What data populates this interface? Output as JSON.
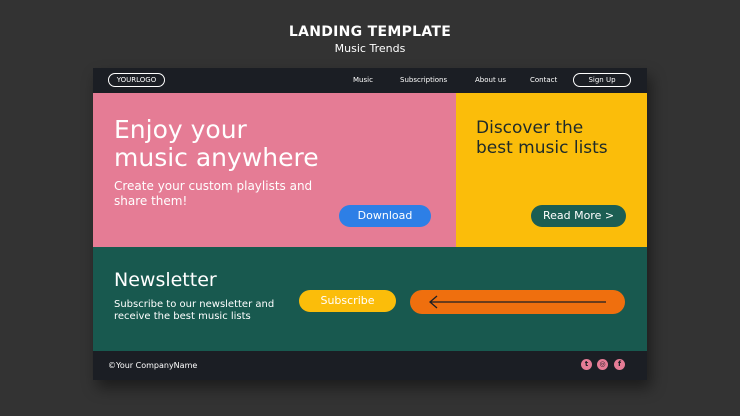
{
  "heading": {
    "title": "LANDING TEMPLATE",
    "subtitle": "Music Trends"
  },
  "nav": {
    "logo": "YOURLOGO",
    "links": [
      "Music",
      "Subscriptions",
      "About us",
      "Contact"
    ],
    "signup": "Sign Up"
  },
  "hero": {
    "title_line1": "Enjoy your",
    "title_line2": "music anywhere",
    "subtitle": "Create your custom playlists and share them!",
    "download_label": "Download"
  },
  "discover": {
    "title_line1": "Discover the",
    "title_line2": "best music lists",
    "readmore_label": "Read More >"
  },
  "newsletter": {
    "title": "Newsletter",
    "text": "Subscribe to our newsletter and receive the best music lists",
    "subscribe_label": "Subscribe",
    "field_icon": "arrow-left-icon"
  },
  "footer": {
    "copyright": "©Your CompanyName",
    "social": [
      {
        "icon": "twitter-icon",
        "glyph": "t"
      },
      {
        "icon": "instagram-icon",
        "glyph": "◎"
      },
      {
        "icon": "facebook-icon",
        "glyph": "f"
      }
    ]
  },
  "colors": {
    "background": "#333333",
    "mockup_dark": "#1b1e24",
    "pink": "#e57c95",
    "yellow": "#fbbd0a",
    "green": "#18594f",
    "blue_button": "#2d7fe6",
    "orange": "#ef6f0e"
  }
}
